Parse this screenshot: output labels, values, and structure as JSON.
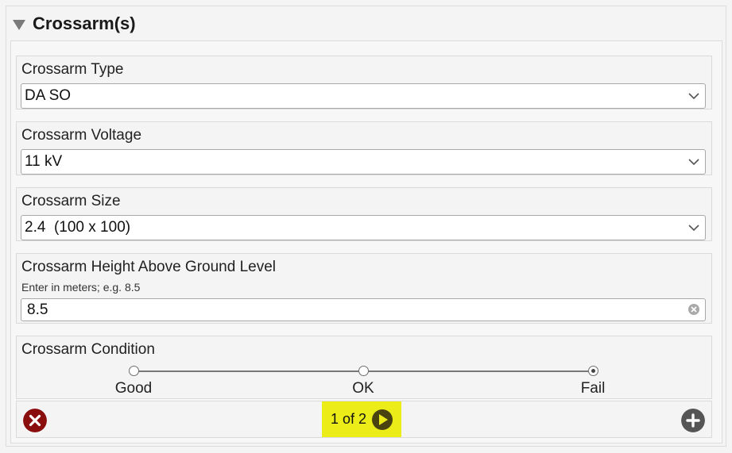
{
  "section": {
    "title": "Crossarm(s)",
    "collapse_icon": "triangle-down-icon"
  },
  "fields": {
    "type": {
      "label": "Crossarm Type",
      "value": "DA SO"
    },
    "voltage": {
      "label": "Crossarm Voltage",
      "value": "11 kV"
    },
    "size": {
      "label": "Crossarm Size",
      "value": "2.4  (100 x 100)"
    },
    "height": {
      "label": "Crossarm Height Above Ground Level",
      "hint": "Enter in meters; e.g. 8.5",
      "value": "8.5"
    },
    "condition": {
      "label": "Crossarm Condition",
      "options": [
        "Good",
        "OK",
        "Fail"
      ],
      "selected": "Fail"
    }
  },
  "footer": {
    "pager_text": "1 of 2",
    "delete_icon": "close-circle-icon",
    "next_icon": "play-next-icon",
    "add_icon": "plus-circle-icon"
  },
  "colors": {
    "delete": "#8b0e0e",
    "add": "#555555",
    "pager_highlight": "#ecec19",
    "next_button": "#4a4310"
  }
}
